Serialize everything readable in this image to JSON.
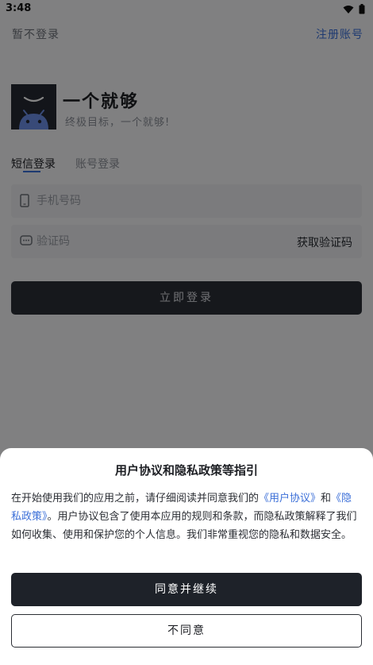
{
  "status_bar": {
    "time": "3:48",
    "icons": [
      "wifi-icon",
      "battery-icon"
    ]
  },
  "top_bar": {
    "skip_label": "暂不登录",
    "register_label": "注册账号"
  },
  "app": {
    "name": "一个就够",
    "slogan": "终极目标，一个就够!"
  },
  "tabs": [
    {
      "label": "短信登录",
      "active": true
    },
    {
      "label": "账号登录",
      "active": false
    }
  ],
  "form": {
    "phone_placeholder": "手机号码",
    "code_placeholder": "验证码",
    "get_code_label": "获取验证码",
    "login_label": "立即登录"
  },
  "dialog": {
    "title": "用户协议和隐私政策等指引",
    "body_part1": "在开始使用我们的应用之前，请仔细阅读并同意我们的",
    "user_agreement_link": "《用户协议》",
    "body_and": "和",
    "privacy_policy_link": "《隐私政策》",
    "body_part2": "。用户协议包含了使用本应用的规则和条款，而隐私政策解释了我们如何收集、使用和保护您的个人信息。我们非常重视您的隐私和数据安全。",
    "agree_label": "同意并继续",
    "disagree_label": "不同意"
  },
  "colors": {
    "accent": "#3b6fd8",
    "dark_button": "#1e2229",
    "overlay": "rgba(0,0,0,0.48)"
  }
}
